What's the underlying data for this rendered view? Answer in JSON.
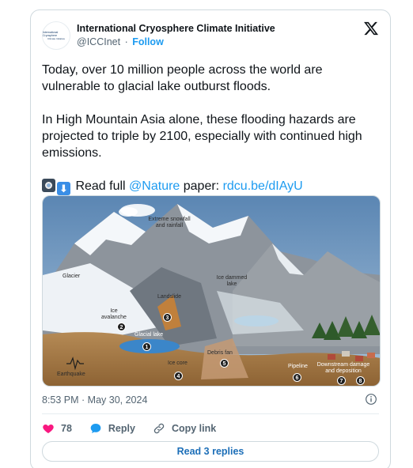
{
  "author": {
    "name": "International Cryosphere Climate Initiative",
    "handle": "@ICCInet",
    "separator": "·",
    "follow_label": "Follow",
    "avatar_text_line1": "International Cryosphere",
    "avatar_text_line2": "Climate Initiative"
  },
  "tweet": {
    "paragraph1": "Today, over 10 million people across the world are vulnerable to glacial lake outburst floods.",
    "paragraph2": "In High Mountain Asia alone, these flooding hazards are projected to triple by 2100, especially with continued high emissions.",
    "read_prefix": "Read full ",
    "mention": "@Nature",
    "mid_text": " paper: ",
    "link_text": "rdcu.be/dIAyU",
    "emojis": [
      "camera-icon",
      "down-arrow-icon"
    ]
  },
  "diagram": {
    "labels": {
      "snow": "Extreme snowfall\nand rainfall",
      "glacier": "Glacier",
      "ice_dammed": "Ice dammed\nlake",
      "landslide": "Landslide",
      "ice_avalanche": "Ice\navalanche",
      "glacial_lake": "Glacial lake",
      "ice_core": "Ice core",
      "debris_fan": "Debris fan",
      "earthquake": "Earthquake",
      "pipeline": "Pipeline",
      "downstream": "Downstream damage\nand deposition"
    },
    "numbers": [
      "1",
      "2",
      "3",
      "4",
      "5",
      "6",
      "7",
      "8"
    ]
  },
  "meta": {
    "timestamp": "8:53 PM · May 30, 2024"
  },
  "actions": {
    "likes": "78",
    "reply_label": "Reply",
    "copy_label": "Copy link"
  },
  "read_replies_label": "Read 3 replies",
  "colors": {
    "link": "#1d9bf0",
    "like": "#f91880",
    "reply_icon": "#1d9bf0"
  }
}
